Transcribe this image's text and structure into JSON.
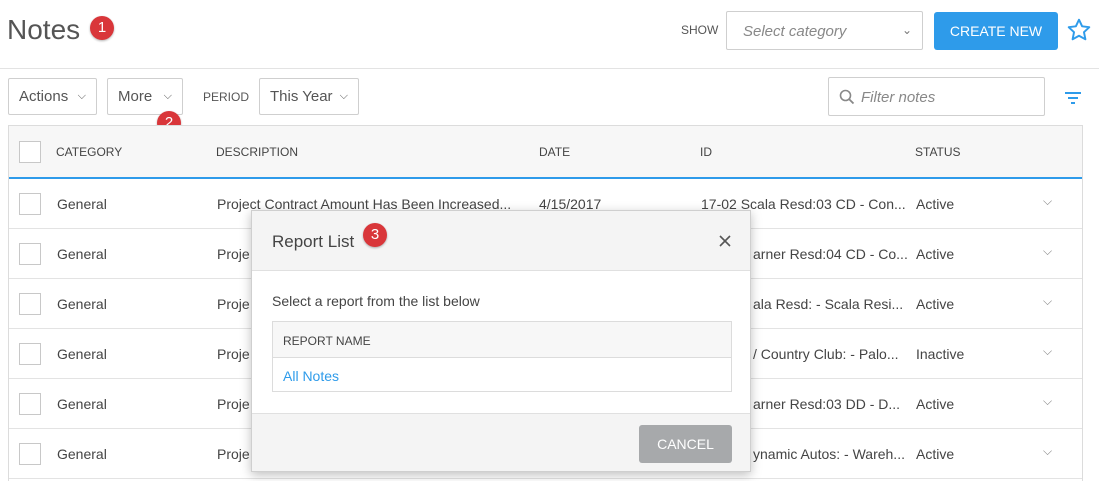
{
  "header": {
    "title": "Notes",
    "show_label": "SHOW",
    "category_placeholder": "Select category",
    "create_button": "CREATE NEW"
  },
  "badges": [
    "1",
    "2",
    "3"
  ],
  "toolbar": {
    "actions_label": "Actions",
    "more_label": "More",
    "period_label": "PERIOD",
    "period_value": "This Year",
    "filter_placeholder": "Filter notes"
  },
  "table": {
    "columns": [
      "CATEGORY",
      "DESCRIPTION",
      "DATE",
      "ID",
      "STATUS"
    ],
    "rows": [
      {
        "category": "General",
        "description": "Project Contract Amount Has Been Increased...",
        "date": "4/15/2017",
        "id": "17-02 Scala Resd:03 CD - Con...",
        "status": "Active"
      },
      {
        "category": "General",
        "description": "Proje",
        "date": "",
        "id": "arner Resd:04 CD - Co...",
        "status": "Active"
      },
      {
        "category": "General",
        "description": "Proje",
        "date": "",
        "id": "ala Resd: - Scala Resi...",
        "status": "Active"
      },
      {
        "category": "General",
        "description": "Proje",
        "date": "",
        "id": "/ Country Club: - Palo...",
        "status": "Inactive"
      },
      {
        "category": "General",
        "description": "Proje",
        "date": "",
        "id": "arner Resd:03 DD - D...",
        "status": "Active"
      },
      {
        "category": "General",
        "description": "Proje",
        "date": "",
        "id": "ynamic Autos: - Wareh...",
        "status": "Active"
      }
    ]
  },
  "modal": {
    "title": "Report List",
    "instruction": "Select a report from the list below",
    "column_header": "REPORT NAME",
    "reports": [
      "All Notes"
    ],
    "cancel_label": "CANCEL"
  },
  "colors": {
    "accent": "#2e9bea",
    "badge": "#d9363a",
    "cancel": "#a7a9ab"
  }
}
